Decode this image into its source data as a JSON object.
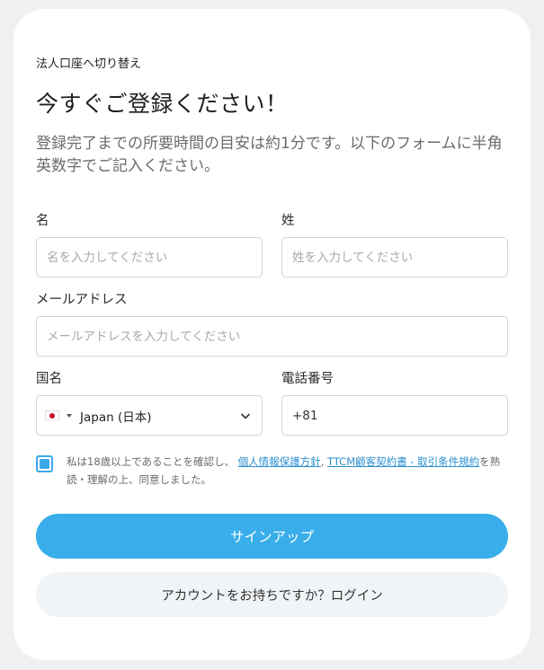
{
  "form": {
    "corporate_link": "法人口座へ切り替え",
    "title": "今すぐご登録ください！",
    "subtitle": "登録完了までの所要時間の目安は約1分です。以下のフォームに半角英数字でご記入ください。",
    "first_name": {
      "label": "名",
      "placeholder": "名を入力してください",
      "value": ""
    },
    "last_name": {
      "label": "姓",
      "placeholder": "姓を入力してください",
      "value": ""
    },
    "email": {
      "label": "メールアドレス",
      "placeholder": "メールアドレスを入力してください",
      "value": ""
    },
    "country": {
      "label": "国名",
      "selected": "Japan (日本)",
      "flag_icon": "japan-flag-icon"
    },
    "phone": {
      "label": "電話番号",
      "value": "+81"
    },
    "consent": {
      "checked": true,
      "text_before": "私は18歳以上であることを確認し、",
      "link_privacy": "個人情報保護方針",
      "separator": ", ",
      "link_terms": "TTCM顧客契約書 - 取引条件規約",
      "text_after": "を熟読・理解の上、同意しました。"
    },
    "signup_label": "サインアップ",
    "login_label": "アカウントをお持ちですか？ログイン"
  },
  "colors": {
    "accent": "#39aeea",
    "link": "#2a8fcf",
    "card_bg": "#ffffff",
    "page_bg": "#eef0f2",
    "secondary_button_bg": "#f1f4f6"
  }
}
